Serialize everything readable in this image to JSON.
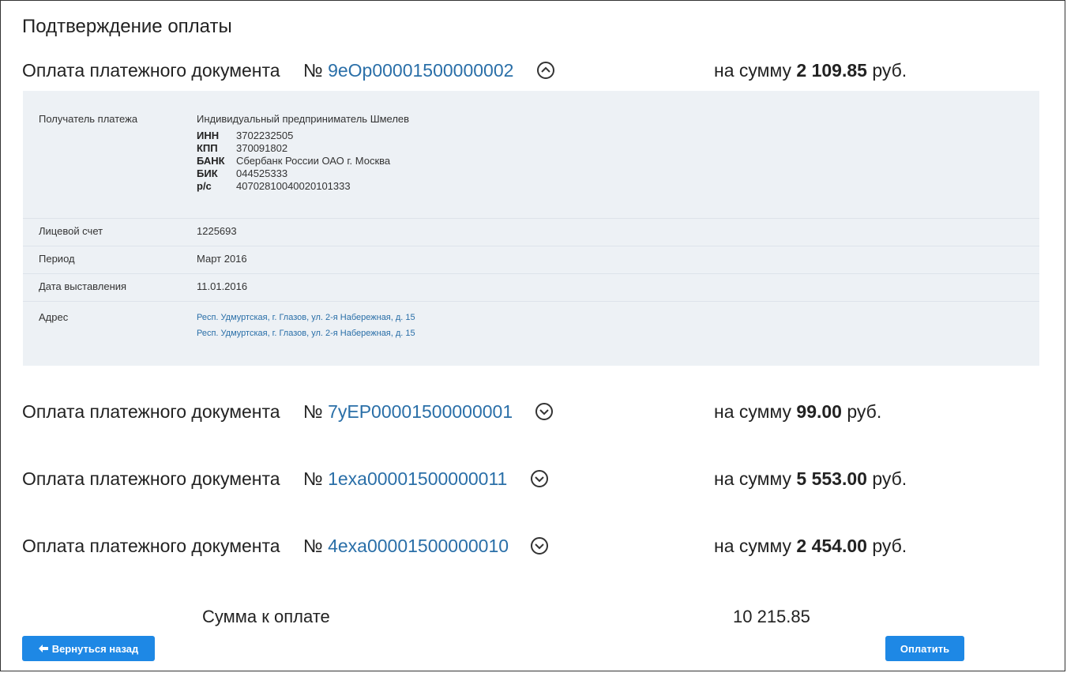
{
  "page": {
    "title": "Подтверждение оплаты"
  },
  "documents": [
    {
      "label": "Оплата платежного документа",
      "no_sign": "№",
      "number": "9eOp00001500000002",
      "expanded": true,
      "sum_prefix": "на сумму",
      "amount": "2 109.85",
      "currency": "руб."
    },
    {
      "label": "Оплата платежного документа",
      "no_sign": "№",
      "number": "7yEP00001500000001",
      "expanded": false,
      "sum_prefix": "на сумму",
      "amount": "99.00",
      "currency": "руб."
    },
    {
      "label": "Оплата платежного документа",
      "no_sign": "№",
      "number": "1exa00001500000011",
      "expanded": false,
      "sum_prefix": "на сумму",
      "amount": "5 553.00",
      "currency": "руб."
    },
    {
      "label": "Оплата платежного документа",
      "no_sign": "№",
      "number": "4exa00001500000010",
      "expanded": false,
      "sum_prefix": "на сумму",
      "amount": "2 454.00",
      "currency": "руб."
    }
  ],
  "details": {
    "recipient": {
      "label": "Получатель платежа",
      "name": "Индивидуальный предприниматель Шмелев",
      "fields": [
        {
          "key": "ИНН",
          "value": "3702232505"
        },
        {
          "key": "КПП",
          "value": "370091802"
        },
        {
          "key": "БАНК",
          "value": "Сбербанк России ОАО г. Москва"
        },
        {
          "key": "БИК",
          "value": "044525333"
        },
        {
          "key": "р/с",
          "value": "40702810040020101333"
        }
      ]
    },
    "account": {
      "label": "Лицевой счет",
      "value": "1225693"
    },
    "period": {
      "label": "Период",
      "value": "Март 2016"
    },
    "issue_date": {
      "label": "Дата выставления",
      "value": "11.01.2016"
    },
    "address": {
      "label": "Адрес",
      "lines": [
        "Респ. Удмуртская, г. Глазов, ул. 2-я Набережная, д. 15",
        "Респ. Удмуртская, г. Глазов, ул. 2-я Набережная, д. 15"
      ]
    }
  },
  "total": {
    "label": "Сумма к оплате",
    "value": "10 215.85"
  },
  "buttons": {
    "back": "Вернуться назад",
    "pay": "Оплатить"
  },
  "colors": {
    "link": "#2a6fa8",
    "button": "#1e88e5",
    "panel": "#edf1f5"
  }
}
